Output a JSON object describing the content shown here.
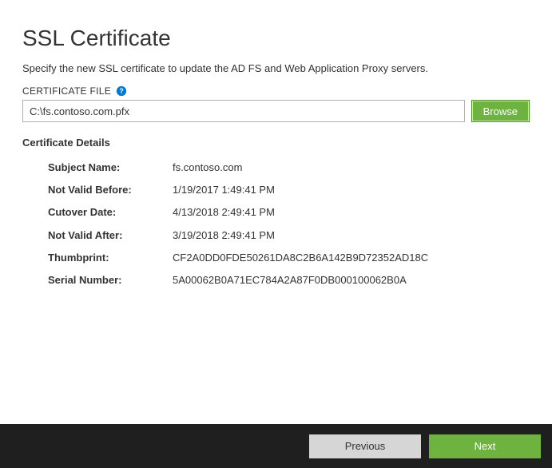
{
  "header": {
    "title": "SSL Certificate",
    "description": "Specify the new SSL certificate to update the AD FS and Web Application Proxy servers."
  },
  "file": {
    "label": "CERTIFICATE FILE",
    "value": "C:\\fs.contoso.com.pfx",
    "browse_label": "Browse"
  },
  "details": {
    "title": "Certificate Details",
    "rows": [
      {
        "label": "Subject Name:",
        "value": "fs.contoso.com"
      },
      {
        "label": "Not Valid Before:",
        "value": "1/19/2017 1:49:41 PM"
      },
      {
        "label": "Cutover Date:",
        "value": "4/13/2018 2:49:41 PM"
      },
      {
        "label": "Not Valid After:",
        "value": "3/19/2018 2:49:41 PM"
      },
      {
        "label": "Thumbprint:",
        "value": "CF2A0DD0FDE50261DA8C2B6A142B9D72352AD18C"
      },
      {
        "label": "Serial Number:",
        "value": "5A00062B0A71EC784A2A87F0DB000100062B0A"
      }
    ]
  },
  "footer": {
    "previous_label": "Previous",
    "next_label": "Next"
  }
}
